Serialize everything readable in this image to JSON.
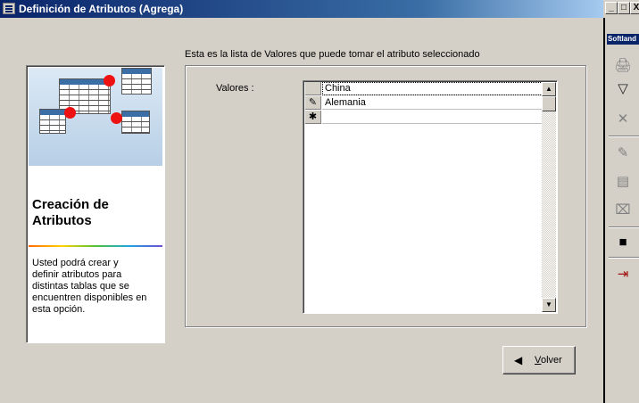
{
  "window": {
    "title": "Definición de Atributos (Agrega)",
    "buttons": {
      "minimize": "_",
      "maximize": "□",
      "close": "X"
    }
  },
  "side_toolbar": {
    "label": "Softland",
    "icons": [
      "print-icon",
      "filter-icon",
      "clear-icon",
      "open-icon",
      "edit-icon",
      "delete-icon",
      "save-icon",
      "exit-icon"
    ]
  },
  "info_panel": {
    "title_line1": "Creación de",
    "title_line2": "Atributos",
    "description_lines": [
      "Usted podrá crear y",
      "definir atributos para",
      "distintas tablas que se",
      "encuentren disponibles en",
      "esta opción."
    ]
  },
  "main": {
    "instruction": "Esta es la lista de Valores que puede tomar el atributo seleccionado",
    "valores_label": "Valores :",
    "grid": {
      "rows": [
        {
          "indicator": "",
          "value": "China"
        },
        {
          "indicator": "✎",
          "value": "Alemania"
        },
        {
          "indicator": "✱",
          "value": ""
        }
      ]
    }
  },
  "buttons": {
    "volver_mnemonic": "V",
    "volver_rest": "olver"
  }
}
